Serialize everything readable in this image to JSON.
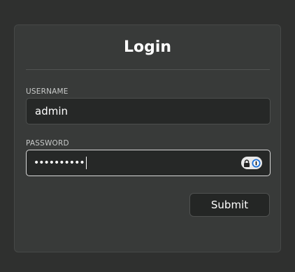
{
  "login": {
    "title": "Login",
    "username_label": "USERNAME",
    "username_value": "admin",
    "password_label": "PASSWORD",
    "password_value": "••••••••••",
    "submit_label": "Submit"
  },
  "icons": {
    "password_manager": "password-manager-icon"
  },
  "colors": {
    "background": "#2f302f",
    "card": "#383a39",
    "input": "#262827",
    "focus_border": "#d8d8d8"
  }
}
